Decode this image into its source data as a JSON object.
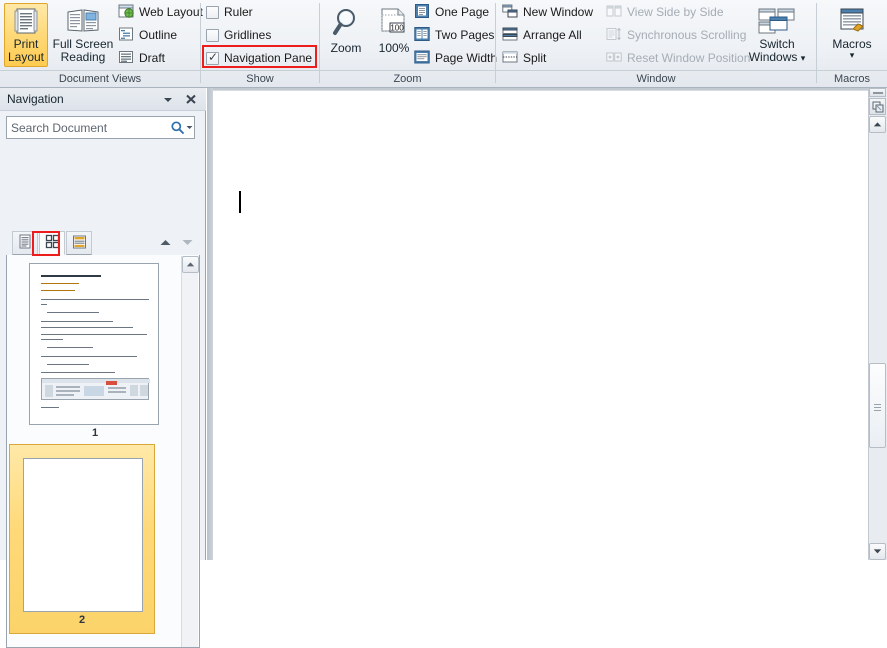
{
  "ribbon": {
    "groups": [
      {
        "label": "Document Views"
      },
      {
        "label": "Show"
      },
      {
        "label": "Zoom"
      },
      {
        "label": "Window"
      },
      {
        "label": "Macros"
      }
    ],
    "document_views": {
      "print_layout": {
        "label_line1": "Print",
        "label_line2": "Layout",
        "icon": "print-layout-icon",
        "selected": true
      },
      "full_screen_reading": {
        "label_line1": "Full Screen",
        "label_line2": "Reading",
        "icon": "full-screen-reading-icon"
      },
      "web_layout": {
        "label": "Web Layout",
        "icon": "web-layout-icon"
      },
      "outline": {
        "label": "Outline",
        "icon": "outline-icon"
      },
      "draft": {
        "label": "Draft",
        "icon": "draft-icon"
      }
    },
    "show": {
      "ruler": {
        "label": "Ruler",
        "checked": false
      },
      "gridlines": {
        "label": "Gridlines",
        "checked": false
      },
      "navigation_pane": {
        "label": "Navigation Pane",
        "checked": true,
        "highlighted": true
      }
    },
    "zoom": {
      "zoom_button": {
        "label": "Zoom",
        "icon": "magnifier-icon"
      },
      "zoom_100": {
        "label": "100%",
        "icon": "page-100-icon"
      },
      "one_page": {
        "label": "One Page",
        "icon": "one-page-icon"
      },
      "two_pages": {
        "label": "Two Pages",
        "icon": "two-pages-icon"
      },
      "page_width": {
        "label": "Page Width",
        "icon": "page-width-icon"
      }
    },
    "window": {
      "new_window": {
        "label": "New Window",
        "icon": "new-window-icon",
        "disabled": false
      },
      "arrange_all": {
        "label": "Arrange All",
        "icon": "arrange-all-icon",
        "disabled": false
      },
      "split": {
        "label": "Split",
        "icon": "split-icon",
        "disabled": false
      },
      "view_side_by_side": {
        "label": "View Side by Side",
        "icon": "side-by-side-icon",
        "disabled": true
      },
      "synchronous_scrolling": {
        "label": "Synchronous Scrolling",
        "icon": "sync-scroll-icon",
        "disabled": true
      },
      "reset_window_position": {
        "label": "Reset Window Position",
        "icon": "reset-window-icon",
        "disabled": true
      },
      "switch_windows": {
        "label_line1": "Switch",
        "label_line2": "Windows",
        "icon": "switch-windows-icon",
        "has_dropdown": true
      }
    },
    "macros": {
      "macros_button": {
        "label": "Macros",
        "icon": "macros-icon",
        "has_dropdown": true
      }
    }
  },
  "navigation": {
    "title": "Navigation",
    "dropdown_icon": "chevron-down-icon",
    "close_icon": "close-icon",
    "search": {
      "placeholder": "Search Document",
      "value": "",
      "search_icon": "magnifier-icon",
      "options_icon": "chevron-down-icon"
    },
    "tabs": [
      {
        "name": "browse-headings",
        "icon": "headings-list-icon",
        "active": false
      },
      {
        "name": "browse-pages",
        "icon": "page-thumbnails-icon",
        "active": true,
        "highlighted": true
      },
      {
        "name": "browse-results",
        "icon": "search-results-icon",
        "active": false
      }
    ],
    "nav_prev_icon": "arrow-up-icon",
    "nav_next_icon": "arrow-down-icon",
    "thumbnails": [
      {
        "number": "1",
        "selected": false,
        "has_content": true
      },
      {
        "number": "2",
        "selected": true,
        "has_content": false
      }
    ],
    "scrollbar": {
      "up_icon": "arrow-up-icon"
    }
  },
  "document": {
    "caret_visible": true,
    "scrollbar": {
      "split_handle": "split-handle",
      "browse_object_icon": "select-browse-object-icon",
      "up_icon": "arrow-up-icon",
      "down_icon": "arrow-down-icon",
      "thumb_grip_icon": "grip-icon"
    }
  },
  "colors": {
    "selection_yellow": "#ffd978",
    "annotation_red": "#ee1d1d",
    "ribbon_bg": "#eef1f5",
    "accent_blue": "#2e6fb0"
  }
}
